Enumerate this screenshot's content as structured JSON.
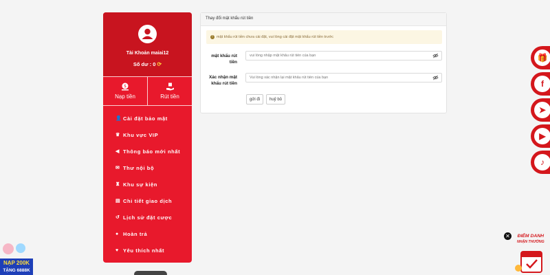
{
  "sidebar": {
    "account_label": "Tài Khoản maiai12",
    "balance_label": "Số dư : 0",
    "deposit_label": "Nạp tiền",
    "withdraw_label": "Rút tiền",
    "menu": [
      {
        "label": "Cài đặt bảo mật",
        "icon": "user-lock-icon"
      },
      {
        "label": "Khu vực VIP",
        "icon": "crown-icon"
      },
      {
        "label": "Thông báo mới nhất",
        "icon": "megaphone-icon"
      },
      {
        "label": "Thư nội bộ",
        "icon": "envelope-icon"
      },
      {
        "label": "Khu sự kiện",
        "icon": "trophy-icon"
      },
      {
        "label": "Chi tiết giao dịch",
        "icon": "receipt-icon"
      },
      {
        "label": "Lịch sử đặt cược",
        "icon": "history-icon"
      },
      {
        "label": "Hoàn trả",
        "icon": "refund-icon"
      },
      {
        "label": "Yêu thích nhất",
        "icon": "heart-icon"
      }
    ]
  },
  "panel": {
    "title": "Thay đổi mật khẩu rút tiền",
    "notice": "mật khẩu rút tiền chưa cài đặt, vui lòng cài đặt mật khẩu rút tiền trước",
    "password_label": "mật khẩu rút tiền",
    "password_placeholder": "vui lòng nhập mật khẩu rút tiền của bạn",
    "confirm_label": "Xác nhận mật khẩu rút tiền",
    "confirm_placeholder": "Vui lòng xác nhận lại mật khẩu rút tiền của bạn",
    "submit_label": "gửi đi",
    "cancel_label": "huỷ bỏ"
  },
  "promo": {
    "left_line1": "NẠP 200K",
    "left_line2": "TẶNG 6888K",
    "right_line1": "ĐIỂM DANH",
    "right_line2": "NHẬN THƯỞNG"
  },
  "social": [
    "gift-icon",
    "facebook-icon",
    "telegram-icon",
    "youtube-icon",
    "tiktok-icon"
  ],
  "colors": {
    "brand_red": "#e8192c",
    "dark_red": "#c8141f",
    "notice_bg": "#fcf6e3"
  }
}
